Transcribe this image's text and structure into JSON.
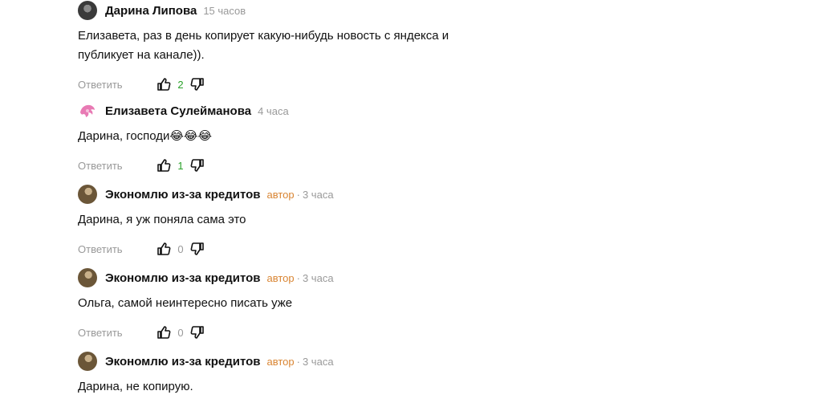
{
  "comments": [
    {
      "author": "Дарина Липова",
      "time": "15 часов",
      "badge": "",
      "text": "Елизавета, раз в день копирует какую-нибудь новость с яндекса и публикует на канале)).",
      "reply_label": "Ответить",
      "likes": "2",
      "avatar_icon": "dark-photo-avatar"
    },
    {
      "author": "Елизавета Сулейманова",
      "time": "4 часа",
      "badge": "",
      "text": "Дарина, господи😂😂😂",
      "reply_label": "Ответить",
      "likes": "1",
      "avatar_icon": "pink-hair-avatar"
    },
    {
      "author": "Экономлю из-за кредитов",
      "time": "3 часа",
      "badge": "автор",
      "sep": "·",
      "text": "Дарина, я уж поняла сама это",
      "reply_label": "Ответить",
      "likes": "0",
      "avatar_icon": "brown-photo-avatar"
    },
    {
      "author": "Экономлю из-за кредитов",
      "time": "3 часа",
      "badge": "автор",
      "sep": "·",
      "text": "Ольга, самой неинтересно писать уже",
      "reply_label": "Ответить",
      "likes": "0",
      "avatar_icon": "brown-photo-avatar"
    },
    {
      "author": "Экономлю из-за кредитов",
      "time": "3 часа",
      "badge": "автор",
      "sep": "·",
      "text": "Дарина, не копирую.",
      "reply_label": "",
      "likes": "",
      "avatar_icon": "brown-photo-avatar"
    }
  ],
  "colors": {
    "like_positive": "#2aa12a",
    "muted": "#999999",
    "author_badge": "#d98533"
  }
}
